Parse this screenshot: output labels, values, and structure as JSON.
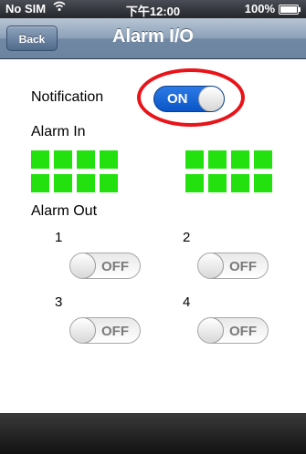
{
  "status_bar": {
    "carrier": "No SIM",
    "wifi_icon": "wifi-icon",
    "time": "下午12:00",
    "battery": "100%"
  },
  "nav": {
    "back_label": "Back",
    "title": "Alarm I/O"
  },
  "notification": {
    "label": "Notification",
    "state": "ON"
  },
  "alarm_in": {
    "label": "Alarm In",
    "indicator_color": "#22e10e",
    "groups": [
      {
        "count": 8
      },
      {
        "count": 8
      }
    ]
  },
  "alarm_out": {
    "label": "Alarm Out",
    "ports": [
      {
        "number": "1",
        "state": "OFF"
      },
      {
        "number": "2",
        "state": "OFF"
      },
      {
        "number": "3",
        "state": "OFF"
      },
      {
        "number": "4",
        "state": "OFF"
      }
    ]
  },
  "colors": {
    "highlight": "#e8141a",
    "toggle_on": "#0a56c8",
    "nav_bar": "#7188a4"
  }
}
